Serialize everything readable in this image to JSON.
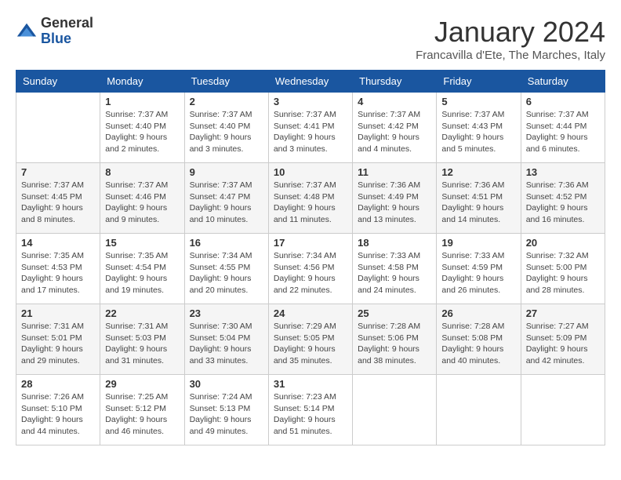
{
  "logo": {
    "line1": "General",
    "line2": "Blue"
  },
  "title": "January 2024",
  "location": "Francavilla d'Ete, The Marches, Italy",
  "days_header": [
    "Sunday",
    "Monday",
    "Tuesday",
    "Wednesday",
    "Thursday",
    "Friday",
    "Saturday"
  ],
  "weeks": [
    [
      {
        "day": "",
        "info": ""
      },
      {
        "day": "1",
        "info": "Sunrise: 7:37 AM\nSunset: 4:40 PM\nDaylight: 9 hours\nand 2 minutes."
      },
      {
        "day": "2",
        "info": "Sunrise: 7:37 AM\nSunset: 4:40 PM\nDaylight: 9 hours\nand 3 minutes."
      },
      {
        "day": "3",
        "info": "Sunrise: 7:37 AM\nSunset: 4:41 PM\nDaylight: 9 hours\nand 3 minutes."
      },
      {
        "day": "4",
        "info": "Sunrise: 7:37 AM\nSunset: 4:42 PM\nDaylight: 9 hours\nand 4 minutes."
      },
      {
        "day": "5",
        "info": "Sunrise: 7:37 AM\nSunset: 4:43 PM\nDaylight: 9 hours\nand 5 minutes."
      },
      {
        "day": "6",
        "info": "Sunrise: 7:37 AM\nSunset: 4:44 PM\nDaylight: 9 hours\nand 6 minutes."
      }
    ],
    [
      {
        "day": "7",
        "info": "Sunrise: 7:37 AM\nSunset: 4:45 PM\nDaylight: 9 hours\nand 8 minutes."
      },
      {
        "day": "8",
        "info": "Sunrise: 7:37 AM\nSunset: 4:46 PM\nDaylight: 9 hours\nand 9 minutes."
      },
      {
        "day": "9",
        "info": "Sunrise: 7:37 AM\nSunset: 4:47 PM\nDaylight: 9 hours\nand 10 minutes."
      },
      {
        "day": "10",
        "info": "Sunrise: 7:37 AM\nSunset: 4:48 PM\nDaylight: 9 hours\nand 11 minutes."
      },
      {
        "day": "11",
        "info": "Sunrise: 7:36 AM\nSunset: 4:49 PM\nDaylight: 9 hours\nand 13 minutes."
      },
      {
        "day": "12",
        "info": "Sunrise: 7:36 AM\nSunset: 4:51 PM\nDaylight: 9 hours\nand 14 minutes."
      },
      {
        "day": "13",
        "info": "Sunrise: 7:36 AM\nSunset: 4:52 PM\nDaylight: 9 hours\nand 16 minutes."
      }
    ],
    [
      {
        "day": "14",
        "info": "Sunrise: 7:35 AM\nSunset: 4:53 PM\nDaylight: 9 hours\nand 17 minutes."
      },
      {
        "day": "15",
        "info": "Sunrise: 7:35 AM\nSunset: 4:54 PM\nDaylight: 9 hours\nand 19 minutes."
      },
      {
        "day": "16",
        "info": "Sunrise: 7:34 AM\nSunset: 4:55 PM\nDaylight: 9 hours\nand 20 minutes."
      },
      {
        "day": "17",
        "info": "Sunrise: 7:34 AM\nSunset: 4:56 PM\nDaylight: 9 hours\nand 22 minutes."
      },
      {
        "day": "18",
        "info": "Sunrise: 7:33 AM\nSunset: 4:58 PM\nDaylight: 9 hours\nand 24 minutes."
      },
      {
        "day": "19",
        "info": "Sunrise: 7:33 AM\nSunset: 4:59 PM\nDaylight: 9 hours\nand 26 minutes."
      },
      {
        "day": "20",
        "info": "Sunrise: 7:32 AM\nSunset: 5:00 PM\nDaylight: 9 hours\nand 28 minutes."
      }
    ],
    [
      {
        "day": "21",
        "info": "Sunrise: 7:31 AM\nSunset: 5:01 PM\nDaylight: 9 hours\nand 29 minutes."
      },
      {
        "day": "22",
        "info": "Sunrise: 7:31 AM\nSunset: 5:03 PM\nDaylight: 9 hours\nand 31 minutes."
      },
      {
        "day": "23",
        "info": "Sunrise: 7:30 AM\nSunset: 5:04 PM\nDaylight: 9 hours\nand 33 minutes."
      },
      {
        "day": "24",
        "info": "Sunrise: 7:29 AM\nSunset: 5:05 PM\nDaylight: 9 hours\nand 35 minutes."
      },
      {
        "day": "25",
        "info": "Sunrise: 7:28 AM\nSunset: 5:06 PM\nDaylight: 9 hours\nand 38 minutes."
      },
      {
        "day": "26",
        "info": "Sunrise: 7:28 AM\nSunset: 5:08 PM\nDaylight: 9 hours\nand 40 minutes."
      },
      {
        "day": "27",
        "info": "Sunrise: 7:27 AM\nSunset: 5:09 PM\nDaylight: 9 hours\nand 42 minutes."
      }
    ],
    [
      {
        "day": "28",
        "info": "Sunrise: 7:26 AM\nSunset: 5:10 PM\nDaylight: 9 hours\nand 44 minutes."
      },
      {
        "day": "29",
        "info": "Sunrise: 7:25 AM\nSunset: 5:12 PM\nDaylight: 9 hours\nand 46 minutes."
      },
      {
        "day": "30",
        "info": "Sunrise: 7:24 AM\nSunset: 5:13 PM\nDaylight: 9 hours\nand 49 minutes."
      },
      {
        "day": "31",
        "info": "Sunrise: 7:23 AM\nSunset: 5:14 PM\nDaylight: 9 hours\nand 51 minutes."
      },
      {
        "day": "",
        "info": ""
      },
      {
        "day": "",
        "info": ""
      },
      {
        "day": "",
        "info": ""
      }
    ]
  ]
}
